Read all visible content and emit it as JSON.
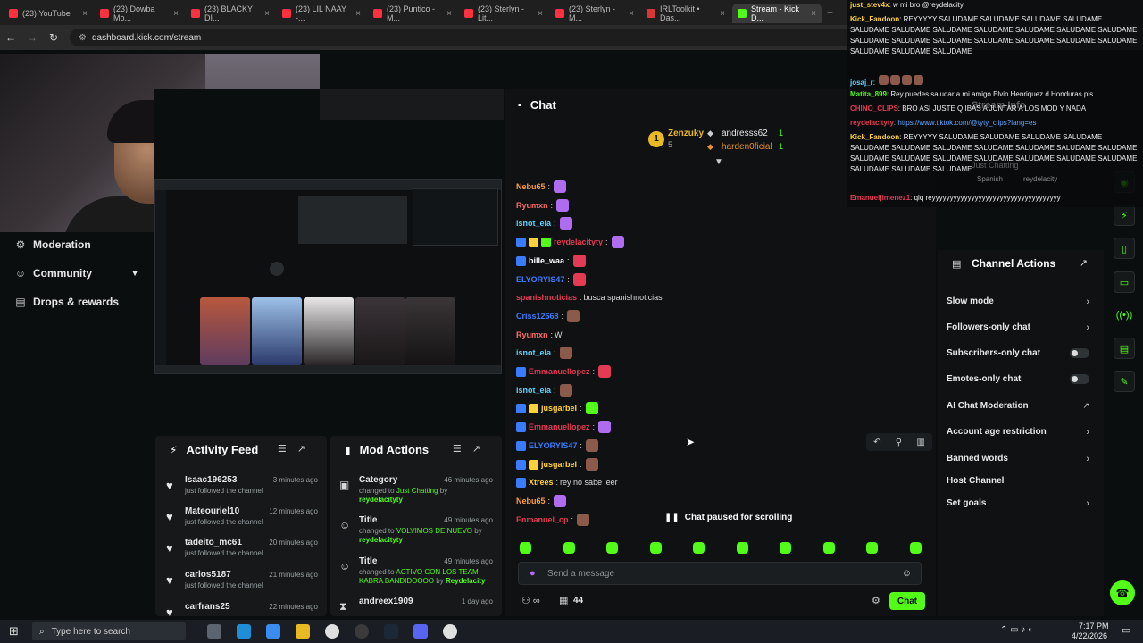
{
  "browser": {
    "tabs": [
      {
        "label": "(23) YouTube",
        "color": "#ff3040"
      },
      {
        "label": "(23) Dowba Mo...",
        "color": "#ff3040"
      },
      {
        "label": "(23) BLACKY DI...",
        "color": "#ff3040"
      },
      {
        "label": "(23) LIL NAAY -...",
        "color": "#ff3040"
      },
      {
        "label": "(23) Puntico - M...",
        "color": "#ff3040"
      },
      {
        "label": "(23) Sterlyn - Lit...",
        "color": "#ff3040"
      },
      {
        "label": "(23) Sterlyn - M...",
        "color": "#ff3040"
      },
      {
        "label": "IRLToolkit • Das...",
        "color": "#d93636"
      },
      {
        "label": "Stream - Kick D...",
        "color": "#53fc18"
      }
    ],
    "url": "dashboard.kick.com/stream"
  },
  "nav": {
    "items": [
      {
        "label": "Moderation",
        "icon": "moderation-icon"
      },
      {
        "label": "Community",
        "icon": "community-icon"
      },
      {
        "label": "Drops & rewards",
        "icon": "drops-icon"
      }
    ]
  },
  "activity_feed": {
    "title": "Activity Feed",
    "items": [
      {
        "user": "Isaac196253",
        "desc": "just followed the channel",
        "time": "3 minutes ago"
      },
      {
        "user": "Mateouriel10",
        "desc": "just followed the channel",
        "time": "12 minutes ago"
      },
      {
        "user": "tadeito_mc61",
        "desc": "just followed the channel",
        "time": "20 minutes ago"
      },
      {
        "user": "carlos5187",
        "desc": "just followed the channel",
        "time": "21 minutes ago"
      },
      {
        "user": "carfrans25",
        "desc": "",
        "time": "22 minutes ago"
      }
    ]
  },
  "mod_actions": {
    "title": "Mod Actions",
    "items": [
      {
        "title": "Category",
        "pre": "changed to ",
        "value": "Just Chatting",
        "mid": " by ",
        "user": "reydelacityty",
        "time": "46 minutes ago",
        "icon": "category-icon"
      },
      {
        "title": "Title",
        "pre": "changed to ",
        "value": "VOLVIMOS DE NUEVO",
        "mid": " by ",
        "user": "reydelacityty",
        "time": "49 minutes ago",
        "icon": "title-icon"
      },
      {
        "title": "Title",
        "pre": "changed to ",
        "value": "ACTIVO CON LOS TEAM KABRA BANDIDOOOO",
        "mid": " by ",
        "user": "Reydelacity",
        "time": "49 minutes ago",
        "icon": "title-icon"
      },
      {
        "title": "andreex1909",
        "pre": "",
        "value": "",
        "mid": "",
        "user": "",
        "time": "1 day ago",
        "icon": "timeout-icon"
      }
    ]
  },
  "chat": {
    "title": "Chat",
    "leaderboard": {
      "first": {
        "name": "Zenzuky",
        "count": "5"
      },
      "others": [
        {
          "name": "andresss62",
          "count": "1"
        },
        {
          "name": "harden0ficial",
          "count": "1"
        }
      ]
    },
    "messages": [
      {
        "user": "Nebu65",
        "color": "#ff9f43",
        "text": "",
        "emote": "#b06cf0"
      },
      {
        "user": "Ryumxn",
        "color": "#ff6b6b",
        "text": "",
        "emote": "#b06cf0"
      },
      {
        "user": "isnot_ela",
        "color": "#5fd3ff",
        "text": "",
        "emote": "#b06cf0"
      },
      {
        "user": "reydelacityty",
        "color": "#e33b54",
        "text": "",
        "emote": "#b06cf0"
      },
      {
        "user": "bille_waa",
        "color": "#ffffff",
        "text": "",
        "emote": "#e33b54"
      },
      {
        "user": "ELYORYIS47",
        "color": "#3a7cff",
        "text": "",
        "emote": "#e33b54"
      },
      {
        "user": "spanishnoticias",
        "color": "#e33b54",
        "text": "busca spanishnoticias",
        "emote": ""
      },
      {
        "user": "Criss12668",
        "color": "#3a7cff",
        "text": "",
        "emote": "#8b5a4a"
      },
      {
        "user": "Ryumxn",
        "color": "#ff6b6b",
        "text": "W",
        "emote": ""
      },
      {
        "user": "isnot_ela",
        "color": "#5fd3ff",
        "text": "",
        "emote": "#8b5a4a"
      },
      {
        "user": "Emmanuellopez",
        "color": "#e33b54",
        "text": "",
        "emote": "#e33b54"
      },
      {
        "user": "isnot_ela",
        "color": "#5fd3ff",
        "text": "",
        "emote": "#8b5a4a"
      },
      {
        "user": "jusgarbel",
        "color": "#ffd23a",
        "text": "",
        "emote": "#53fc18"
      },
      {
        "user": "Emmanuellopez",
        "color": "#e33b54",
        "text": "",
        "emote": "#b06cf0"
      },
      {
        "user": "ELYORYIS47",
        "color": "#3a7cff",
        "text": "",
        "emote": "#8b5a4a"
      },
      {
        "user": "jusgarbel",
        "color": "#ffd23a",
        "text": "",
        "emote": "#8b5a4a"
      },
      {
        "user": "Xtrees",
        "color": "#ffd23a",
        "text": "rey no sabe leer",
        "emote": ""
      },
      {
        "user": "Nebu65",
        "color": "#ff9f43",
        "text": "",
        "emote": "#b06cf0"
      },
      {
        "user": "Enmanuel_cp",
        "color": "#e33b54",
        "text": "",
        "emote": "#8b5a4a"
      }
    ],
    "paused_text": "Chat paused for scrolling",
    "input_placeholder": "Send a message",
    "viewer_count": "44",
    "send_label": "Chat"
  },
  "channel_actions": {
    "title": "Channel Actions",
    "items": [
      {
        "label": "Slow mode",
        "control": "chevron"
      },
      {
        "label": "Followers-only chat",
        "control": "chevron"
      },
      {
        "label": "Subscribers-only chat",
        "control": "toggle"
      },
      {
        "label": "Emotes-only chat",
        "control": "toggle"
      },
      {
        "label": "AI Chat Moderation",
        "control": "external"
      },
      {
        "label": "Account age restriction",
        "control": "chevron"
      },
      {
        "label": "Banned words",
        "control": "chevron"
      },
      {
        "label": "Host Channel",
        "control": "none"
      },
      {
        "label": "Set goals",
        "control": "chevron"
      }
    ]
  },
  "overlay": {
    "lines": [
      {
        "user": "just_stev4x",
        "text": ": w mi bro @reydelacity"
      },
      {
        "user": "Kick_Fandoon",
        "text": ": REYYYYY SALUDAME SALUDAME SALUDAME SALUDAME SALUDAME SALUDAME SALUDAME SALUDAME SALUDAME SALUDAME SALUDAME SALUDAME SALUDAME SALUDAME SALUDAME SALUDAME SALUDAME SALUDAME SALUDAME SALUDAME SALUDAME"
      },
      {
        "user": "josaj_r",
        "text": ":"
      },
      {
        "user": "Matita_899",
        "text": ": Rey puedes saludar a mi amigo Elvin Henriquez d Honduras pls"
      },
      {
        "user": "CHINO_CLIPS",
        "text": ": BRO ASI JUSTE Q IBAS A JUNTAR A LOS MOD Y NADA"
      },
      {
        "user": "reydelacityty",
        "text": ": https://www.tiktok.com/@tyty_clips?lang=es"
      },
      {
        "user": "Kick_Fandoon",
        "text": ": REYYYYY SALUDAME SALUDAME SALUDAME SALUDAME SALUDAME SALUDAME SALUDAME SALUDAME SALUDAME SALUDAME SALUDAME SALUDAME SALUDAME SALUDAME SALUDAME SALUDAME SALUDAME SALUDAME SALUDAME SALUDAME SALUDAME"
      },
      {
        "user": "Emanueljimenez1",
        "text": ": qlq reyyyyyyyyyyyyyyyyyyyyyyyyyyyyyyyyyyyy"
      }
    ],
    "stream_info_peek": "Stream Info",
    "category_peek": "Just Chatting",
    "tags_peek": [
      "Spanish",
      "reydelacity"
    ]
  },
  "taskbar": {
    "search_placeholder": "Type here to search",
    "time": "7:17 PM",
    "date": "4/22/2026"
  }
}
